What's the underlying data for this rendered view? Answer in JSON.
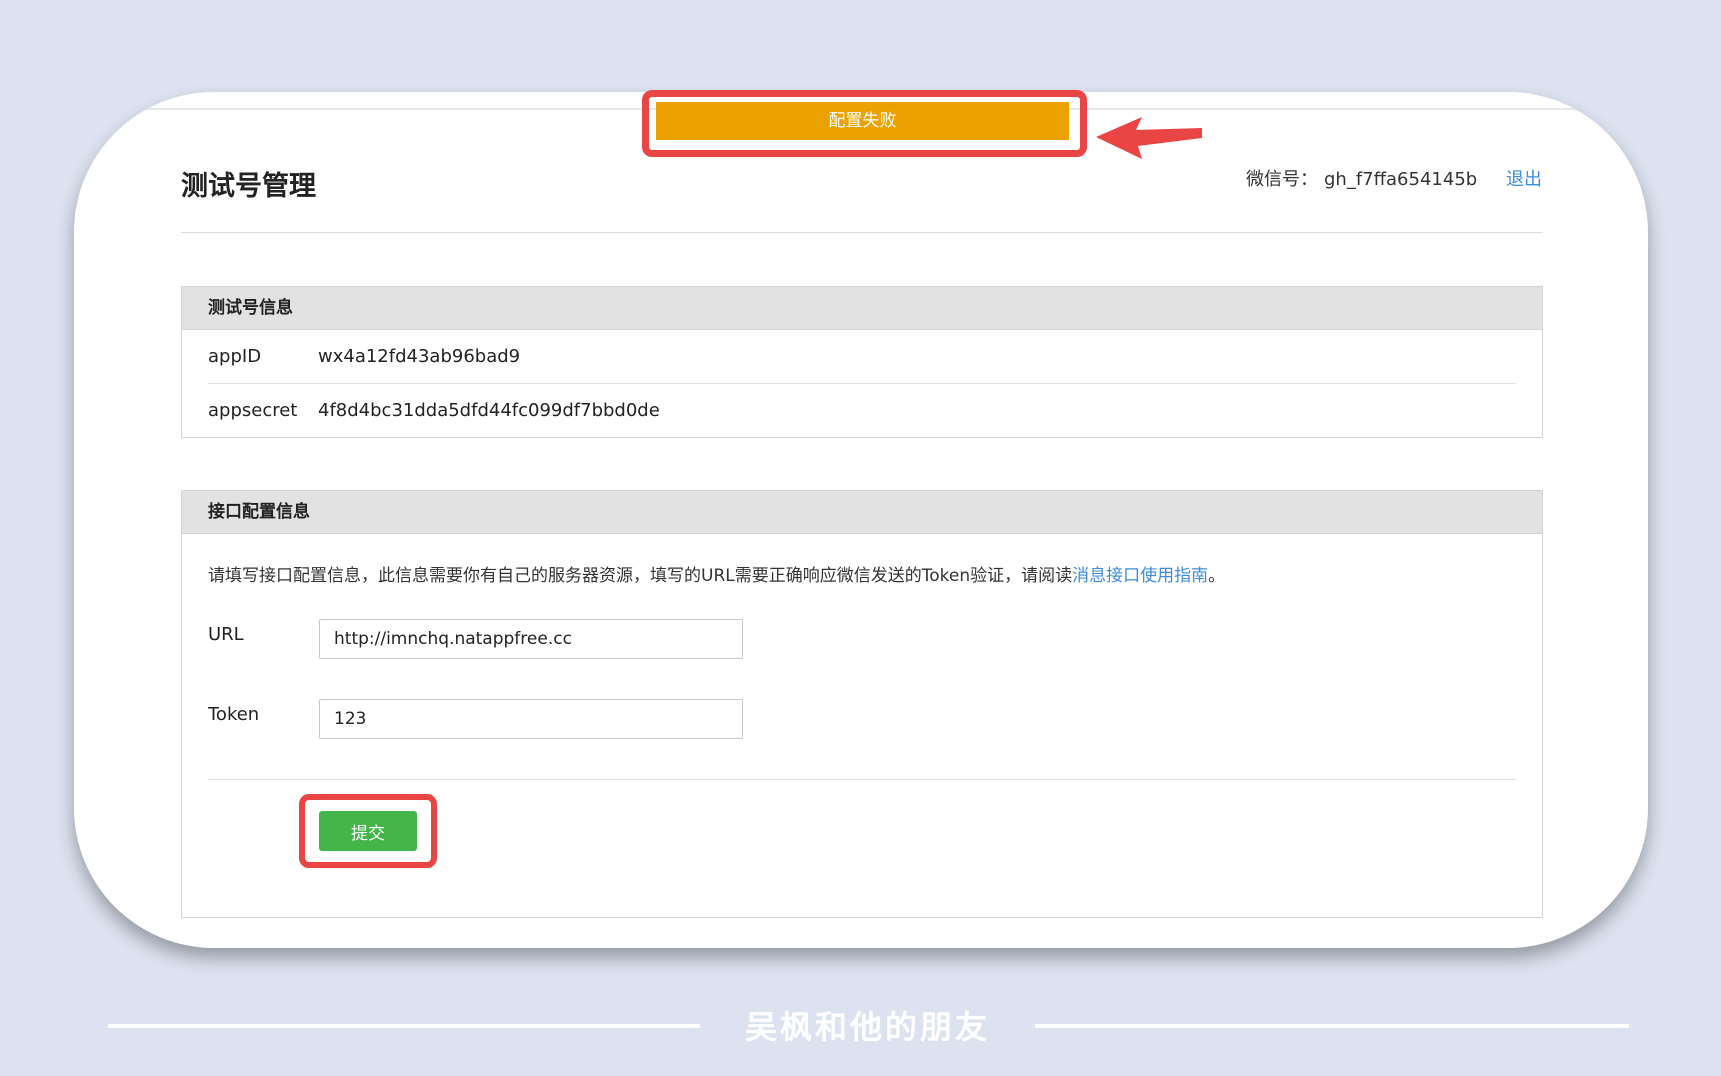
{
  "header": {
    "title": "测试号管理",
    "account_label": "微信号：",
    "account_value": "gh_f7ffa654145b",
    "logout": "退出"
  },
  "alert": {
    "text": "配置失败",
    "color": "#eba200"
  },
  "info_panel": {
    "title": "测试号信息",
    "rows": [
      {
        "key": "appID",
        "value": "wx4a12fd43ab96bad9"
      },
      {
        "key": "appsecret",
        "value": "4f8d4bc31dda5dfd44fc099df7bbd0de"
      }
    ]
  },
  "config_panel": {
    "title": "接口配置信息",
    "description": "请填写接口配置信息，此信息需要你有自己的服务器资源，填写的URL需要正确响应微信发送的Token验证，请阅读",
    "guide_link": "消息接口使用指南",
    "description_end": "。",
    "url_label": "URL",
    "url_value": "http://imnchq.natappfree.cc",
    "token_label": "Token",
    "token_value": "123",
    "submit": "提交"
  },
  "footer": {
    "text": "吴枫和他的朋友"
  },
  "colors": {
    "highlight": "#ea4545",
    "submit": "#44b549",
    "link": "#3c8ce0",
    "background": "#dde2f0"
  },
  "icons": {
    "arrow": "left-arrow-icon"
  }
}
